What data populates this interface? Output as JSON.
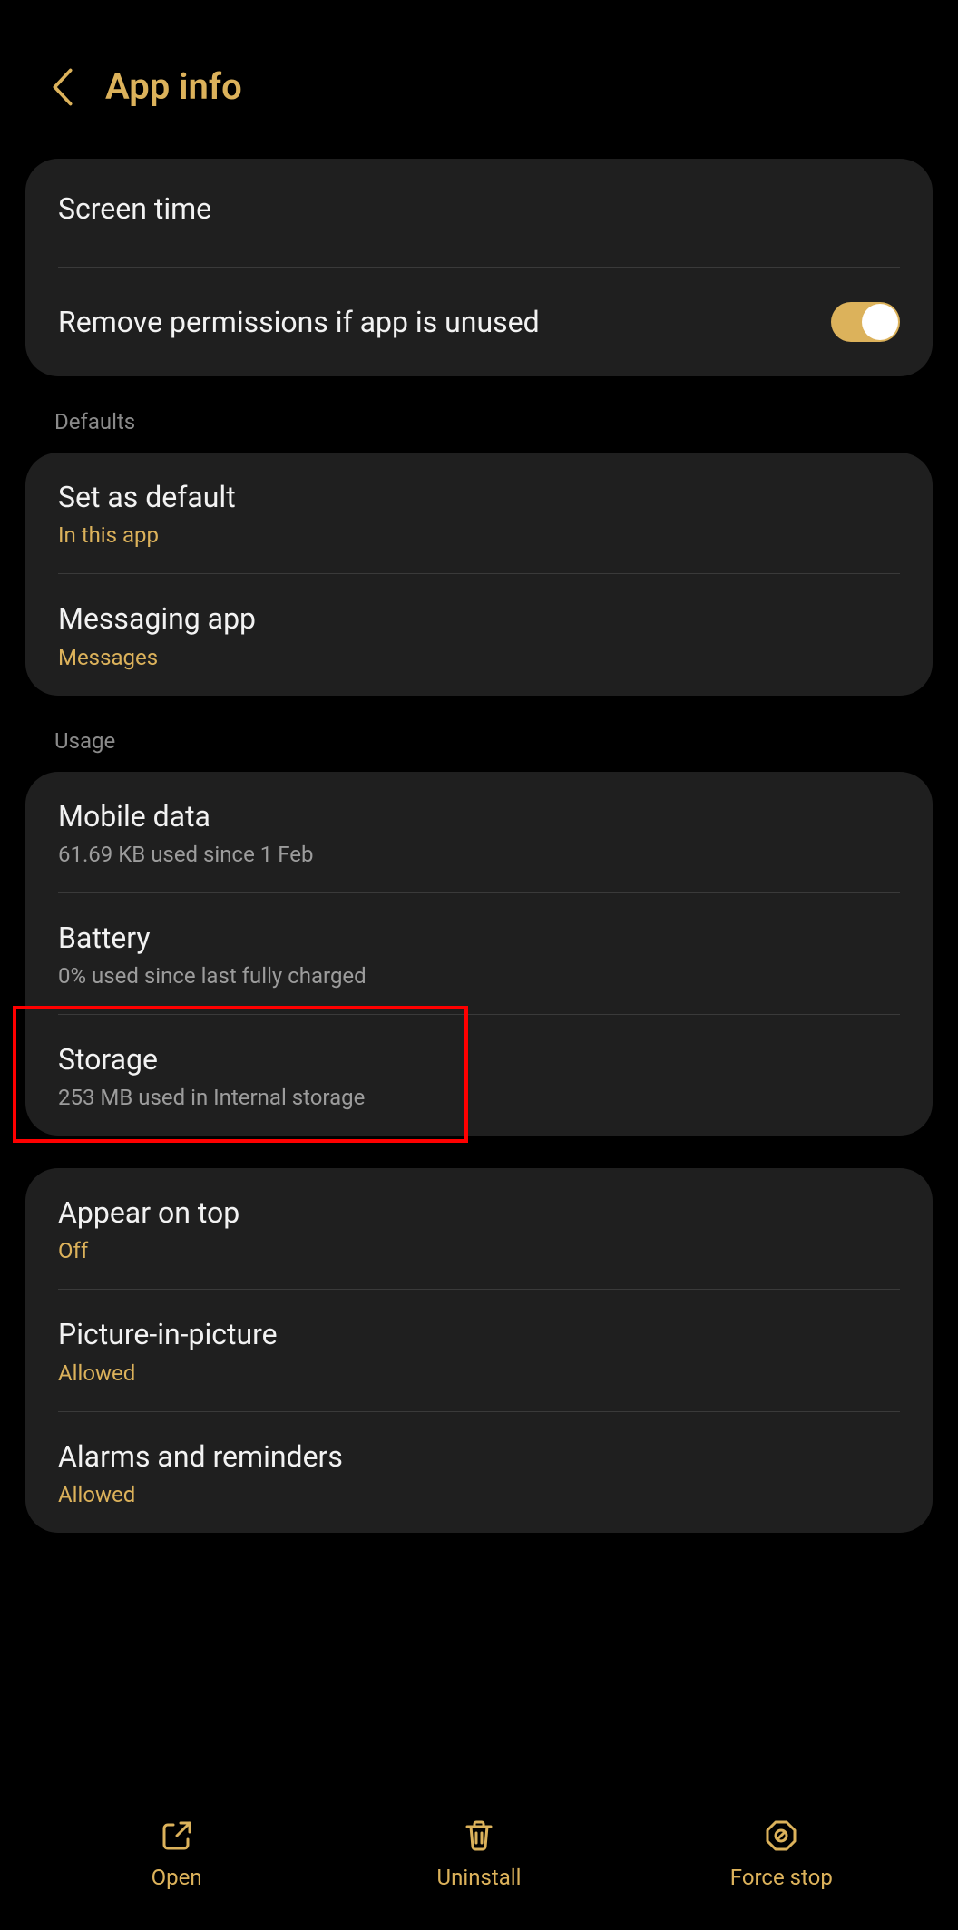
{
  "header": {
    "title": "App info"
  },
  "card1": {
    "screen_time": "Screen time",
    "remove_perm": "Remove permissions if app is unused"
  },
  "sections": {
    "defaults": "Defaults",
    "usage": "Usage"
  },
  "defaults": {
    "set_default": {
      "title": "Set as default",
      "sub": "In this app"
    },
    "messaging": {
      "title": "Messaging app",
      "sub": "Messages"
    }
  },
  "usage": {
    "mobile_data": {
      "title": "Mobile data",
      "sub": "61.69 KB used since 1 Feb"
    },
    "battery": {
      "title": "Battery",
      "sub": "0% used since last fully charged"
    },
    "storage": {
      "title": "Storage",
      "sub": "253 MB used in Internal storage"
    }
  },
  "extra": {
    "appear_on_top": {
      "title": "Appear on top",
      "sub": "Off"
    },
    "pip": {
      "title": "Picture-in-picture",
      "sub": "Allowed"
    },
    "alarms": {
      "title": "Alarms and reminders",
      "sub": "Allowed"
    }
  },
  "bottom": {
    "open": "Open",
    "uninstall": "Uninstall",
    "force_stop": "Force stop"
  }
}
